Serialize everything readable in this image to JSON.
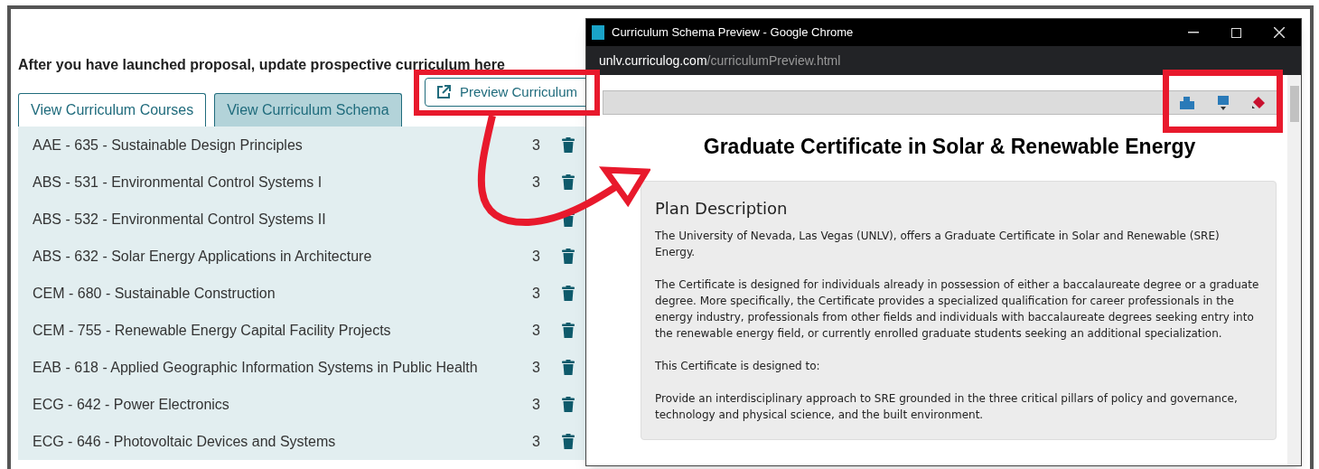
{
  "page": {
    "heading": "After you have launched proposal, update prospective curriculum here",
    "preview_button": "Preview Curriculum",
    "tabs": [
      {
        "label": "View Curriculum Courses",
        "selected": true
      },
      {
        "label": "View Curriculum Schema",
        "selected": false
      }
    ],
    "courses": [
      {
        "name": "AAE - 635 - Sustainable Design Principles",
        "credits": "3"
      },
      {
        "name": "ABS - 531 - Environmental Control Systems I",
        "credits": "3"
      },
      {
        "name": "ABS - 532 - Environmental Control Systems II"
      },
      {
        "name": "ABS - 632 - Solar Energy Applications in Architecture",
        "credits": "3"
      },
      {
        "name": "CEM - 680 - Sustainable Construction",
        "credits": "3"
      },
      {
        "name": "CEM - 755 - Renewable Energy Capital Facility Projects",
        "credits": "3"
      },
      {
        "name": "EAB - 618 - Applied Geographic Information Systems in Public Health",
        "credits": "3"
      },
      {
        "name": "ECG - 642 - Power Electronics",
        "credits": "3"
      },
      {
        "name": "ECG - 646 - Photovoltaic Devices and Systems",
        "credits": "3"
      }
    ]
  },
  "browser_window": {
    "title": "Curriculum Schema Preview - Google Chrome",
    "url_host": "unlv.curriculog.com",
    "url_path": "/curriculumPreview.html",
    "document": {
      "title": "Graduate Certificate in Solar & Renewable Energy",
      "section_title": "Plan Description",
      "paragraphs": [
        "The University of Nevada, Las Vegas (UNLV), offers a Graduate Certificate in Solar and Renewable (SRE) Energy.",
        "The Certificate is designed for individuals already in possession of either a baccalaureate degree or a graduate degree. More specifically, the Certificate provides a specialized qualification for career professionals in the energy industry, professionals from other fields and individuals with baccalaureate degrees seeking entry into the renewable energy field, or currently enrolled graduate students seeking an additional specialization.",
        "This Certificate is designed to:",
        "Provide an interdisciplinary approach to SRE grounded in the three critical pillars of policy and governance, technology and physical science, and the built environment."
      ]
    }
  }
}
